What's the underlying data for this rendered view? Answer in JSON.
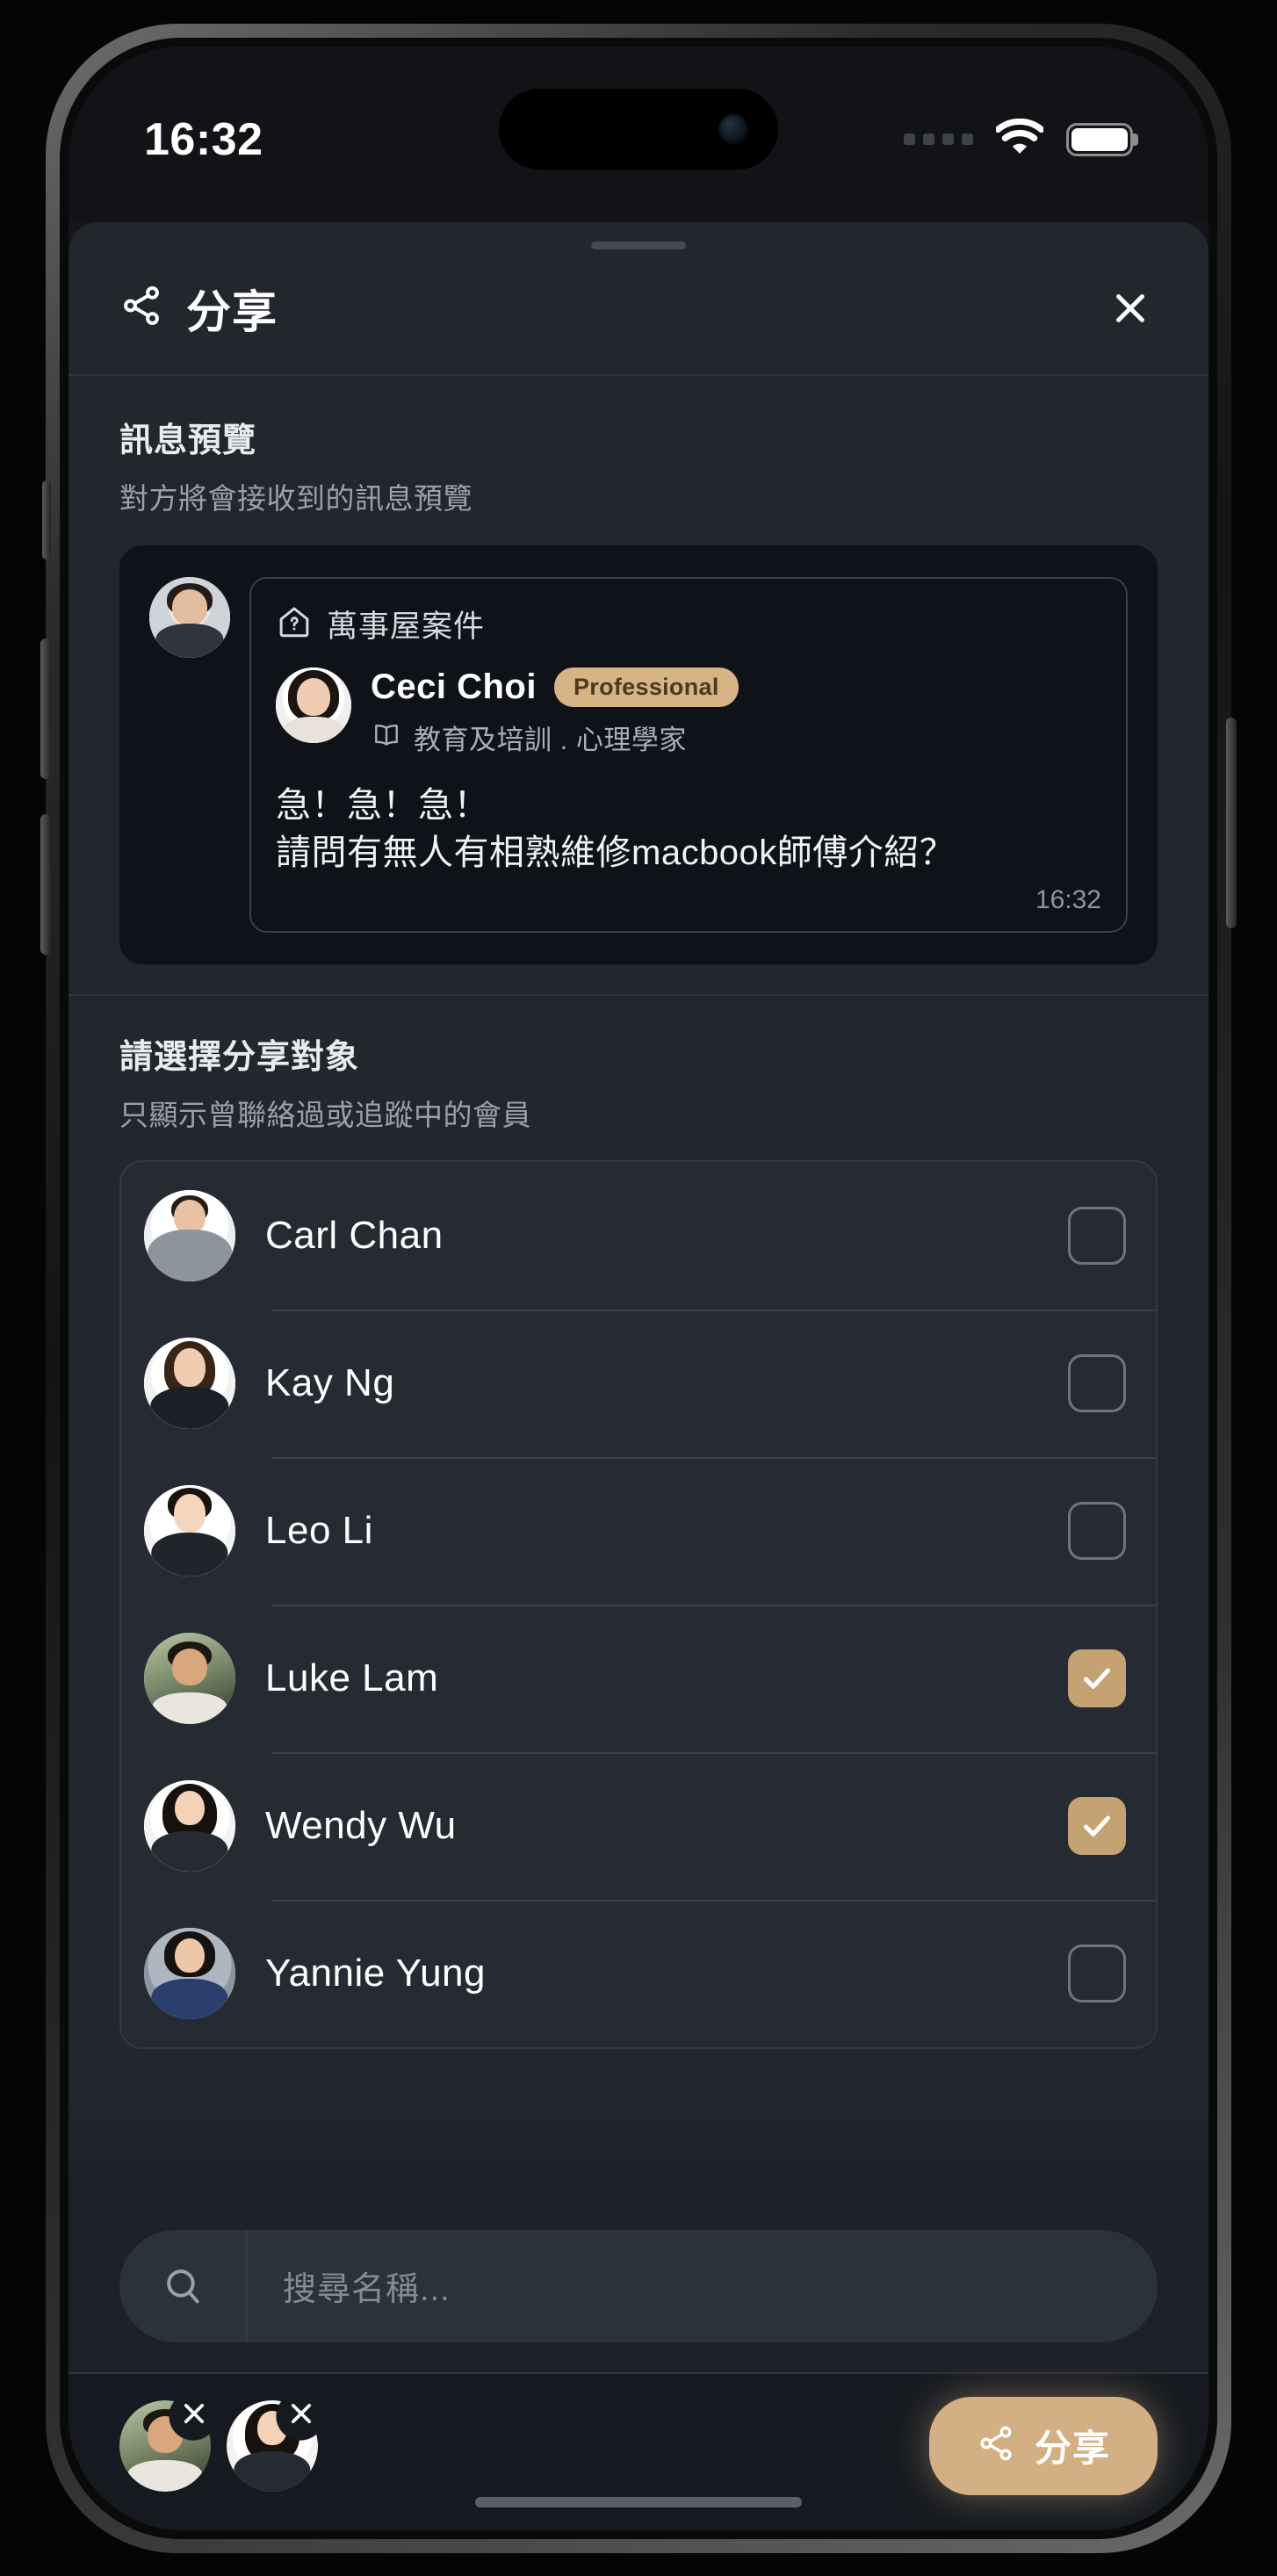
{
  "status_bar": {
    "time": "16:32",
    "signal_icon": "signal-dots-icon",
    "wifi_icon": "wifi-icon",
    "battery_icon": "battery-full-icon"
  },
  "sheet": {
    "header": {
      "icon": "share-icon",
      "title": "分享",
      "close_icon": "close-icon"
    },
    "preview": {
      "title": "訊息預覽",
      "subtitle": "對方將會接收到的訊息預覽",
      "case": {
        "icon": "house-question-icon",
        "label": "萬事屋案件"
      },
      "person": {
        "name": "Ceci Choi",
        "badge": "Professional",
        "category_icon": "book-icon",
        "category": "教育及培訓 . 心理學家"
      },
      "message_lines": [
        "急！急！急！",
        "請問有無人有相熟維修macbook師傅介紹？"
      ],
      "timestamp": "16:32"
    },
    "picker": {
      "title": "請選擇分享對象",
      "subtitle": "只顯示曾聯絡過或追蹤中的會員",
      "contacts": [
        {
          "name": "Carl Chan",
          "checked": false
        },
        {
          "name": "Kay Ng",
          "checked": false
        },
        {
          "name": "Leo Li",
          "checked": false
        },
        {
          "name": "Luke Lam",
          "checked": true
        },
        {
          "name": "Wendy Wu",
          "checked": true
        },
        {
          "name": "Yannie Yung",
          "checked": false
        }
      ]
    },
    "search": {
      "icon": "search-icon",
      "placeholder": "搜尋名稱..."
    },
    "bottom": {
      "selected": [
        {
          "name": "Luke Lam",
          "remove_icon": "close-icon"
        },
        {
          "name": "Wendy Wu",
          "remove_icon": "close-icon"
        }
      ],
      "share_button": {
        "icon": "share-icon",
        "label": "分享"
      }
    }
  },
  "colors": {
    "accent_gold": "#d3b083",
    "badge_bg": "#d7b485",
    "badge_text": "#4d3a1b",
    "checkbox_on": "#c4a271",
    "sheet_bg": "#22262d",
    "card_bg": "#0f1218",
    "list_bg": "#262b33"
  }
}
